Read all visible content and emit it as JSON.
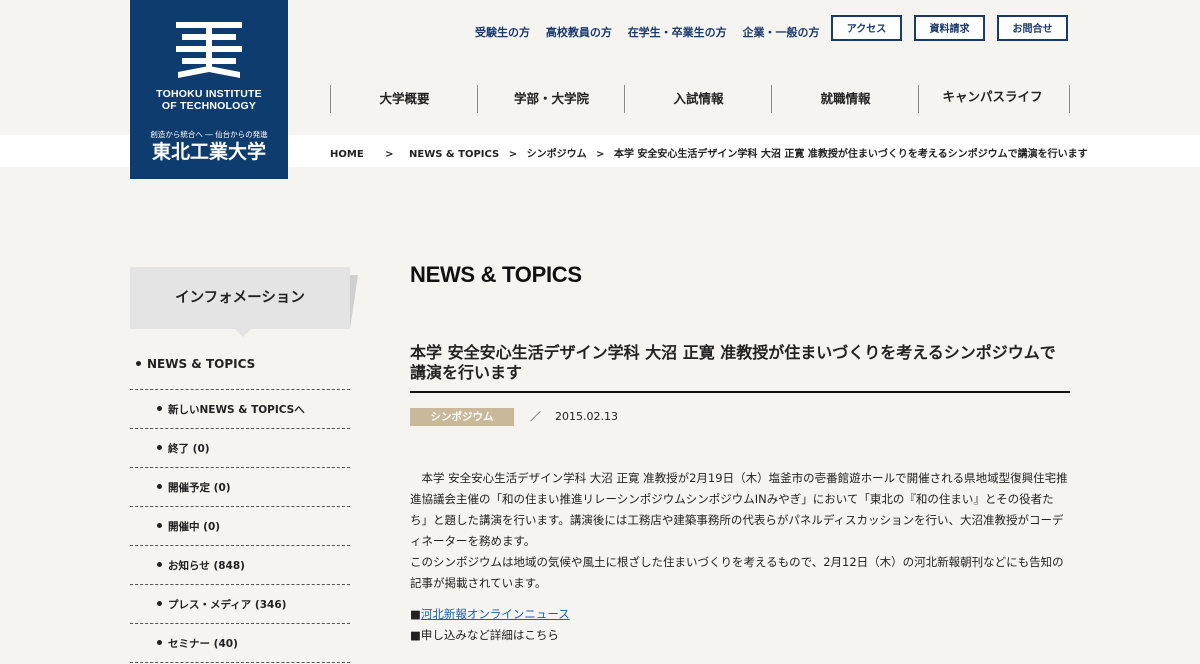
{
  "logo": {
    "name_en_line1": "TOHOKU INSTITUTE",
    "name_en_line2": "OF TECHNOLOGY",
    "tagline": "創造から統合へ ― 仙台からの発進",
    "name_jp": "東北工業大学"
  },
  "top_links": [
    "受験生の方",
    "高校教員の方",
    "在学生・卒業生の方",
    "企業・一般の方"
  ],
  "top_buttons": [
    "アクセス",
    "資料請求",
    "お問合せ"
  ],
  "global_nav": [
    "大学概要",
    "学部・大学院",
    "入試情報",
    "就職情報",
    "キャンパスライフ"
  ],
  "breadcrumb": {
    "home": "HOME",
    "sep1": ">",
    "section": "NEWS & TOPICS",
    "sep2": ">",
    "category": "シンポジウム",
    "sep3": ">",
    "current": "本学 安全安心生活デザイン学科 大沼 正寛 准教授が住まいづくりを考えるシンポジウムで講演を行います"
  },
  "sidebar": {
    "heading": "インフォメーション",
    "top_item": "NEWS & TOPICS",
    "items": [
      "新しいNEWS & TOPICSへ",
      "終了 (0)",
      "開催予定 (0)",
      "開催中 (0)",
      "お知らせ (848)",
      "プレス・メディア (346)",
      "セミナー (40)"
    ]
  },
  "main": {
    "section_title": "NEWS & TOPICS",
    "article_title": "本学 安全安心生活デザイン学科 大沼 正寛 准教授が住まいづくりを考えるシンポジウムで講演を行います",
    "category": "シンポジウム",
    "separator": "／",
    "date": "2015.02.13",
    "paragraph1": "　本学 安全安心生活デザイン学科 大沼 正寛 准教授が2月19日（木）塩釜市の壱番館遊ホールで開催される県地域型復興住宅推進協議会主催の「和の住まい推進リレーシンポジウムシンポジウムINみやぎ」において「東北の『和の住まい』とその役者たち」と題した講演を行います。講演後には工務店や建築事務所の代表らがパネルディスカッションを行い、大沼准教授がコーディネーターを務めます。",
    "paragraph2": "このシンポジウムは地域の気候や風土に根ざした住まいづくりを考えるもので、2月12日（木）の河北新報朝刊などにも告知の記事が掲載されています。",
    "link1_prefix": "■",
    "link1_text": "河北新報オンラインニュース",
    "link2_text": "■申し込みなど詳細はこちら"
  },
  "colors": {
    "brand_navy": "#0f3c6e",
    "category_badge": "#c9b99a",
    "link": "#1a5fb4"
  }
}
